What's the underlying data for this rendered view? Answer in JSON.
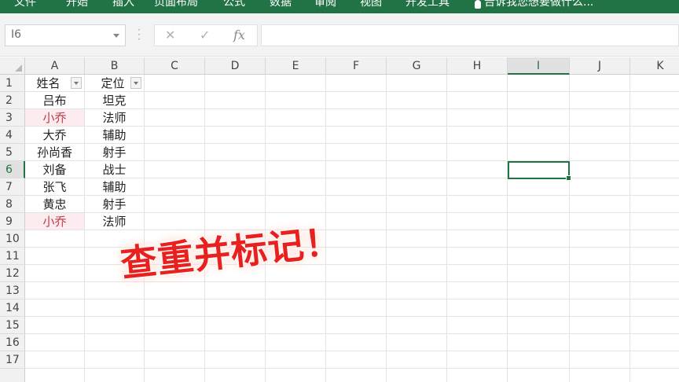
{
  "ribbon": {
    "tabs": [
      "文件",
      "开始",
      "插入",
      "页面布局",
      "公式",
      "数据",
      "审阅",
      "视图",
      "开发工具"
    ],
    "tell_me": "告诉我您想要做什么..."
  },
  "formula_bar": {
    "name_box": "I6",
    "cancel_glyph": "✕",
    "enter_glyph": "✓",
    "fx_label": "fx",
    "formula": ""
  },
  "grid": {
    "columns": [
      "A",
      "B",
      "C",
      "D",
      "E",
      "F",
      "G",
      "H",
      "I",
      "J",
      "K"
    ],
    "rows": [
      "1",
      "2",
      "3",
      "4",
      "5",
      "6",
      "7",
      "8",
      "9",
      "10",
      "11",
      "12",
      "13",
      "14",
      "15",
      "16",
      "17"
    ],
    "active_column": "I",
    "active_row": "6",
    "header": {
      "a": "姓名",
      "b": "定位"
    },
    "data": [
      {
        "name": "吕布",
        "role": "坦克",
        "dup": false
      },
      {
        "name": "小乔",
        "role": "法师",
        "dup": true
      },
      {
        "name": "大乔",
        "role": "辅助",
        "dup": false
      },
      {
        "name": "孙尚香",
        "role": "射手",
        "dup": false
      },
      {
        "name": "刘备",
        "role": "战士",
        "dup": false
      },
      {
        "name": "张飞",
        "role": "辅助",
        "dup": false
      },
      {
        "name": "黄忠",
        "role": "射手",
        "dup": false
      },
      {
        "name": "小乔",
        "role": "法师",
        "dup": true
      }
    ],
    "duplicate_highlight_color": "#fdecef",
    "duplicate_text_color": "#c0394a"
  },
  "overlay": {
    "title": "查重并标记！",
    "color": "#e8201e"
  },
  "theme": {
    "accent": "#217346"
  }
}
